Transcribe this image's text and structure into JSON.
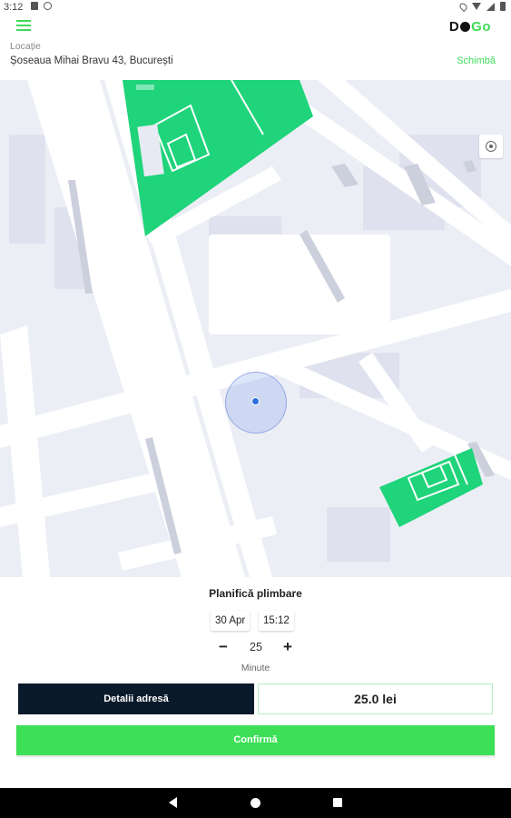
{
  "status_bar": {
    "time": "3:12"
  },
  "app_bar": {
    "logo_prefix": "D",
    "logo_suffix": "Go"
  },
  "location": {
    "label": "Locație",
    "address": "Șoseaua Mihai Bravu 43, București",
    "change_label": "Schimbă"
  },
  "planner": {
    "title": "Planifică plimbare",
    "date": "30 Apr",
    "time": "15:12",
    "duration": "25",
    "duration_unit": "Minute",
    "minus_label": "−",
    "plus_label": "+",
    "details_label": "Detalii adresă",
    "price": "25.0 lei",
    "confirm_label": "Confirmă"
  },
  "colors": {
    "accent": "#3ddc5a",
    "dark_button": "#0b1a2b",
    "map_background": "#eceef6",
    "park": "#1fd47a"
  },
  "icons": {
    "menu": "hamburger-icon",
    "my_location": "crosshair-icon",
    "nav_back": "triangle-back-icon",
    "nav_home": "circle-home-icon",
    "nav_recent": "square-recent-icon"
  }
}
